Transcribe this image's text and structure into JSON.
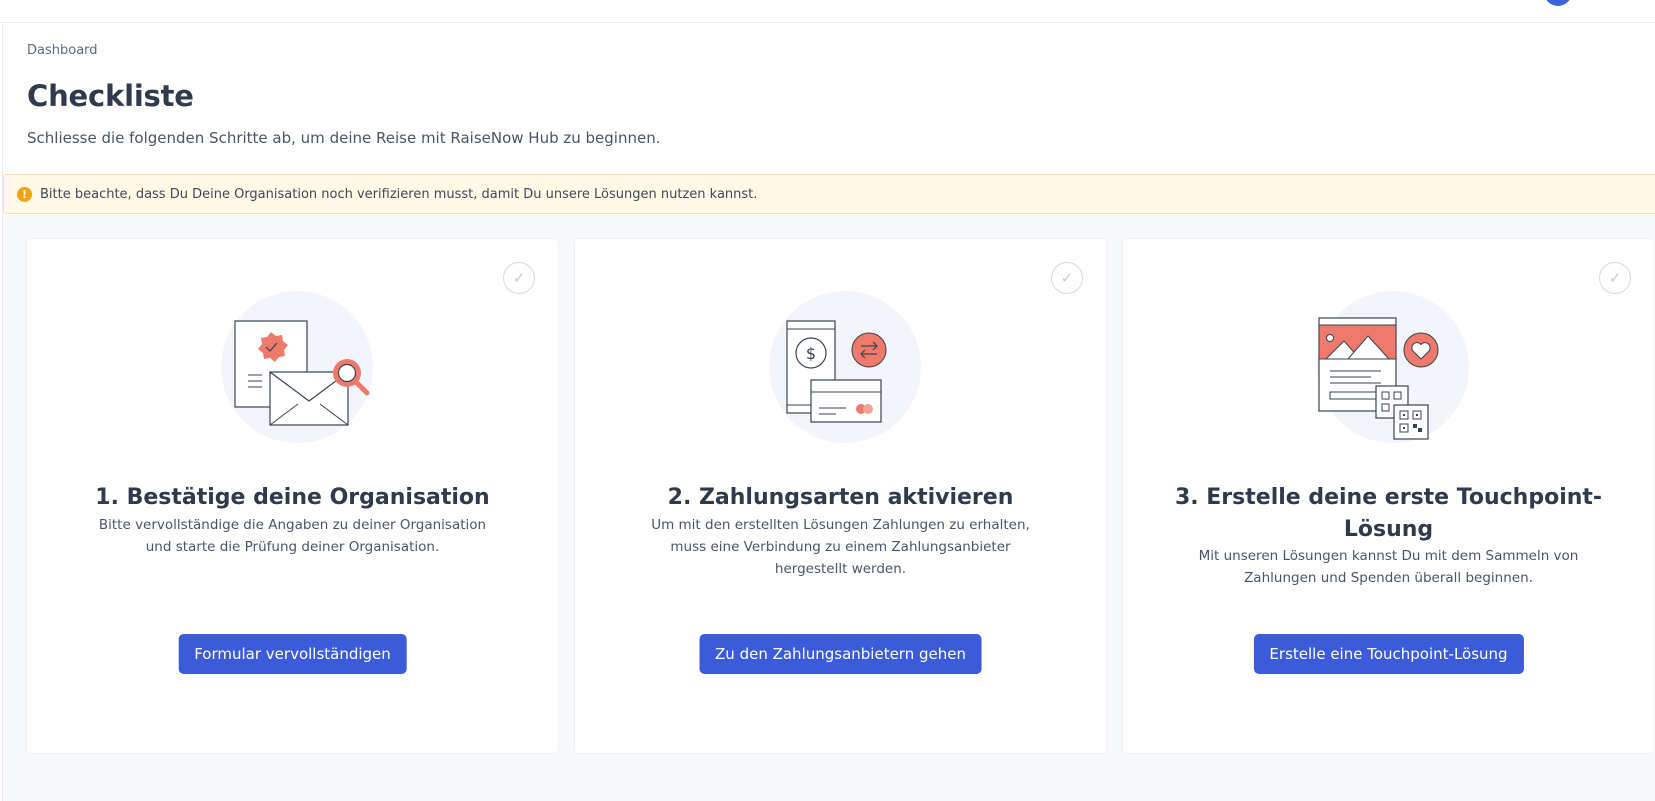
{
  "breadcrumb": "Dashboard",
  "page": {
    "title": "Checkliste",
    "subtitle": "Schliesse die folgenden Schritte ab, um deine Reise mit RaiseNow Hub zu beginnen."
  },
  "alert": {
    "icon": "!",
    "text": "Bitte beachte, dass Du Deine Organisation noch verifizieren musst, damit Du unsere Lösungen nutzen kannst."
  },
  "cards": [
    {
      "title": "1. Bestätige deine Organisation",
      "text": "Bitte vervollständige die Angaben zu deiner Organisation und starte die Prüfung deiner Organisation.",
      "button": "Formular vervollständigen",
      "check_icon": "✓",
      "illustration": "organisation-verification-illustration"
    },
    {
      "title": "2. Zahlungsarten aktivieren",
      "text": "Um mit den erstellten Lösungen Zahlungen zu erhalten, muss eine Verbindung zu einem Zahlungsanbieter hergestellt werden.",
      "button": "Zu den Zahlungsanbietern gehen",
      "check_icon": "✓",
      "illustration": "payment-methods-illustration"
    },
    {
      "title": "3. Erstelle deine erste Touchpoint-Lösung",
      "text": "Mit unseren Lösungen kannst Du mit dem Sammeln von Zahlungen und Spenden überall beginnen.",
      "button": "Erstelle eine Touchpoint-Lösung",
      "check_icon": "✓",
      "illustration": "touchpoint-solution-illustration"
    }
  ],
  "colors": {
    "primary": "#3b5bdb",
    "accent": "#ee7a6b",
    "warning": "#f2a20c"
  }
}
